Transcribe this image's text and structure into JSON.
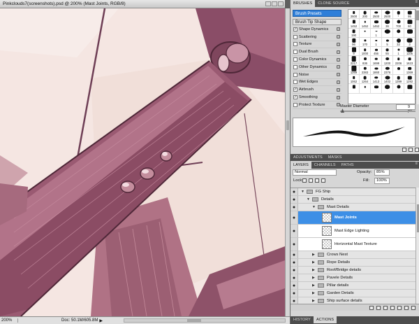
{
  "document": {
    "title": "Pinkclouds7(screenshots).psd @ 200% (Mast Joints, RGB/8)",
    "status_zoom": "200%",
    "status_doc": "Doc: 50.1M/605.8M"
  },
  "brushes_panel": {
    "tabs": [
      "BRUSHES",
      "CLONE SOURCE"
    ],
    "presets_label": "Brush Presets",
    "tip_shape_label": "Brush Tip Shape",
    "options": [
      {
        "label": "Shape Dynamics",
        "checked": true
      },
      {
        "label": "Scattering",
        "checked": false
      },
      {
        "label": "Texture",
        "checked": false
      },
      {
        "label": "Dual Brush",
        "checked": false
      },
      {
        "label": "Color Dynamics",
        "checked": false
      },
      {
        "label": "Other Dynamics",
        "checked": false
      },
      {
        "label": "Noise",
        "checked": false
      },
      {
        "label": "Wet Edges",
        "checked": false
      },
      {
        "label": "Airbrush",
        "checked": true
      },
      {
        "label": "Smoothing",
        "checked": true
      },
      {
        "label": "Protect Texture",
        "checked": false
      }
    ],
    "brush_sizes": [
      "2500",
      "200",
      "2500",
      "2500",
      "*",
      "95",
      "1452",
      "1452",
      "1452",
      "36",
      "700",
      "60",
      "190",
      "",
      "1",
      "",
      "",
      "",
      "96",
      "170",
      "1",
      "5",
      "32",
      "3",
      "9",
      "1000",
      "456",
      "55",
      "1",
      "1105",
      "2217",
      "836",
      "1699",
      "1200",
      "2206",
      "1623",
      "1269",
      "2383",
      "1860",
      "2376",
      "",
      "1369",
      "1062",
      "1264",
      "1413",
      "1402",
      "1399",
      "1292",
      "",
      "",
      "",
      "",
      "",
      ""
    ],
    "master_diameter_label": "Master Diameter",
    "master_diameter_value": "9 px"
  },
  "adjustments_tabs": [
    "ADJUSTMENTS",
    "MASKS"
  ],
  "layers_panel": {
    "tabs": [
      "LAYERS",
      "CHANNELS",
      "PATHS"
    ],
    "blend_mode": "Normal",
    "opacity_label": "Opacity:",
    "opacity_value": "85%",
    "lock_label": "Lock:",
    "fill_label": "Fill:",
    "fill_value": "100%",
    "layers": [
      {
        "name": "FG Ship",
        "kind": "group",
        "depth": 0,
        "open": true
      },
      {
        "name": "Details",
        "kind": "group",
        "depth": 1,
        "open": true
      },
      {
        "name": "Mast Details",
        "kind": "group",
        "depth": 2,
        "open": true
      },
      {
        "name": "Mast Joints",
        "kind": "layer",
        "depth": 3,
        "selected": true
      },
      {
        "name": "Mast Edge Lighting",
        "kind": "layer",
        "depth": 3
      },
      {
        "name": "Horizontal Mast Texture",
        "kind": "layer",
        "depth": 3
      },
      {
        "name": "Crows Nest",
        "kind": "group",
        "depth": 2
      },
      {
        "name": "Rope Details",
        "kind": "group",
        "depth": 2
      },
      {
        "name": "Roof/Bridge details",
        "kind": "group",
        "depth": 2
      },
      {
        "name": "Pavele Details",
        "kind": "group",
        "depth": 2
      },
      {
        "name": "Pillar details",
        "kind": "group",
        "depth": 2
      },
      {
        "name": "Garden Details",
        "kind": "group",
        "depth": 2
      },
      {
        "name": "Ship surface details",
        "kind": "group",
        "depth": 2
      }
    ]
  },
  "bottom_tabs": [
    "HISTORY",
    "ACTIONS"
  ]
}
